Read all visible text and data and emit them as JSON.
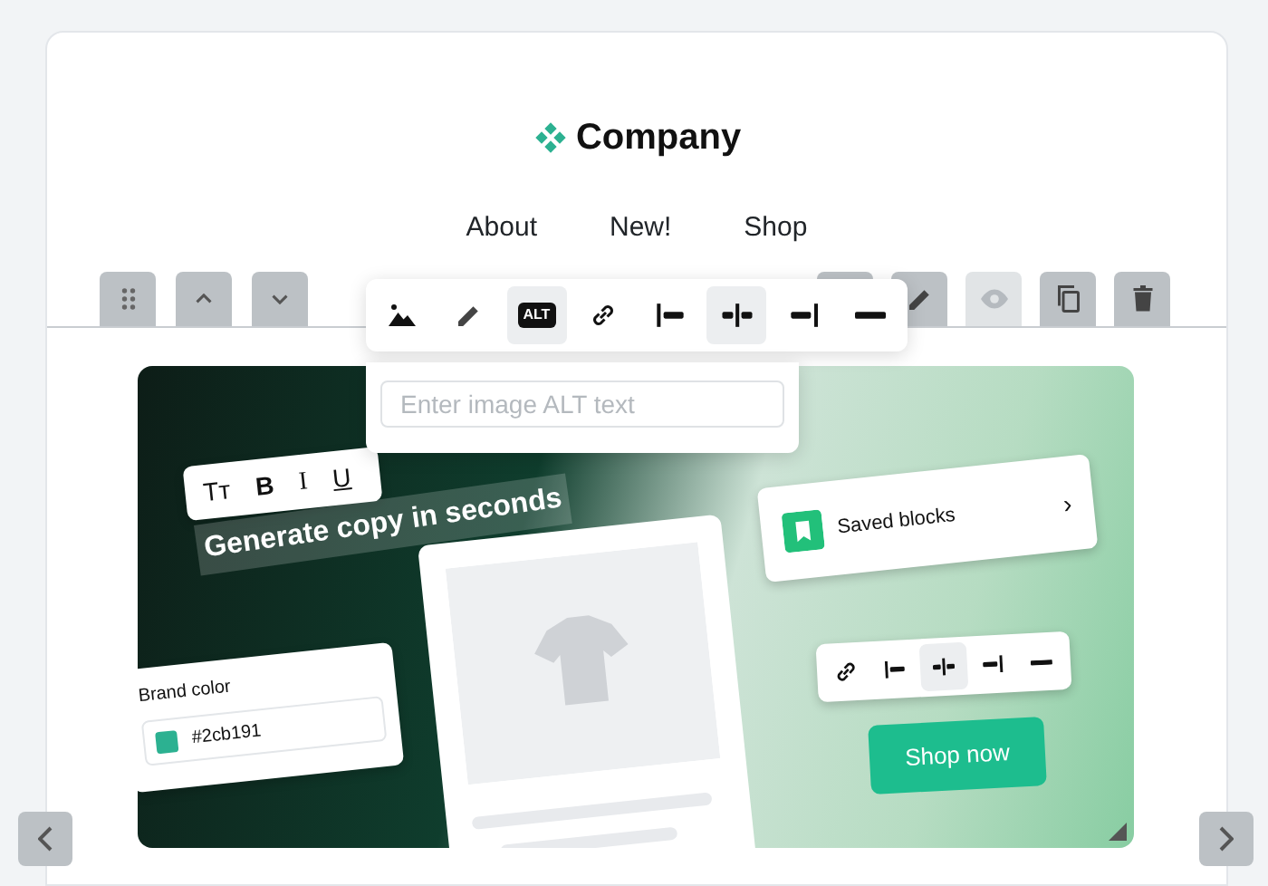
{
  "logo": {
    "text": "Company"
  },
  "nav": [
    {
      "label": "About"
    },
    {
      "label": "New!"
    },
    {
      "label": "Shop"
    }
  ],
  "block_controls_left": [
    {
      "kind": "drag"
    },
    {
      "kind": "up"
    },
    {
      "kind": "down"
    }
  ],
  "block_controls_right": [
    {
      "kind": "blank",
      "disabled": false
    },
    {
      "kind": "edit",
      "disabled": false
    },
    {
      "kind": "preview",
      "disabled": true
    },
    {
      "kind": "duplicate",
      "disabled": false
    },
    {
      "kind": "delete",
      "disabled": false
    }
  ],
  "image_toolbar": [
    {
      "kind": "image",
      "selected": false
    },
    {
      "kind": "edit",
      "selected": false
    },
    {
      "kind": "alt",
      "label": "ALT",
      "selected": true
    },
    {
      "kind": "link",
      "selected": false
    },
    {
      "kind": "align-left",
      "selected": false
    },
    {
      "kind": "align-center",
      "selected": true
    },
    {
      "kind": "align-right",
      "selected": false
    },
    {
      "kind": "full-width",
      "selected": false
    }
  ],
  "alt_popover": {
    "placeholder": "Enter image ALT text"
  },
  "illustration": {
    "text_toolbar": [
      "Tт",
      "B",
      "I",
      "U"
    ],
    "headline": "Generate copy in seconds",
    "brand_color": {
      "label": "Brand color",
      "value": "#2cb191",
      "color": "#2cb191"
    },
    "saved_blocks": {
      "label": "Saved blocks",
      "chevron": "›"
    },
    "align_toolbar": [
      {
        "kind": "link",
        "selected": false
      },
      {
        "kind": "align-left",
        "selected": false
      },
      {
        "kind": "align-center",
        "selected": true
      },
      {
        "kind": "align-right",
        "selected": false
      },
      {
        "kind": "full-width",
        "selected": false
      }
    ],
    "button": "Shop now"
  }
}
